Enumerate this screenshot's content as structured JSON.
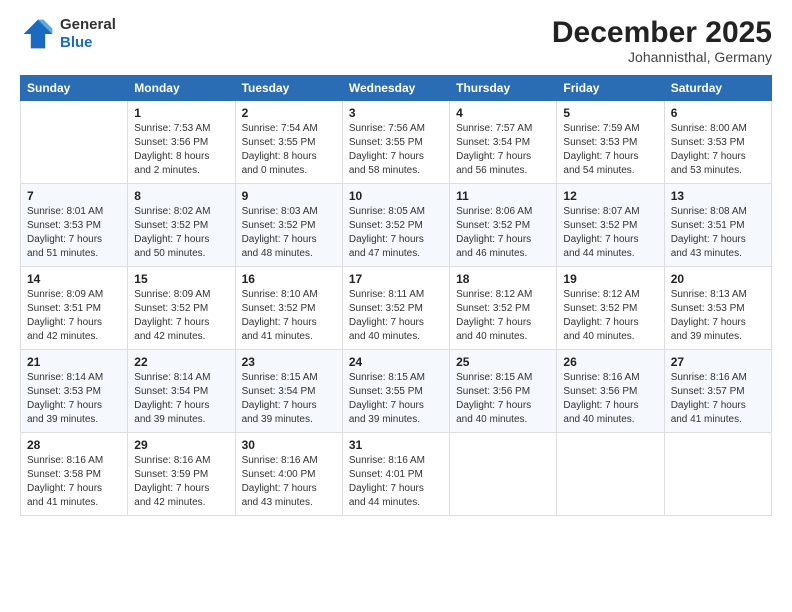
{
  "header": {
    "logo_general": "General",
    "logo_blue": "Blue",
    "month_title": "December 2025",
    "location": "Johannisthal, Germany"
  },
  "days_of_week": [
    "Sunday",
    "Monday",
    "Tuesday",
    "Wednesday",
    "Thursday",
    "Friday",
    "Saturday"
  ],
  "weeks": [
    [
      {
        "day": "",
        "info": ""
      },
      {
        "day": "1",
        "info": "Sunrise: 7:53 AM\nSunset: 3:56 PM\nDaylight: 8 hours\nand 2 minutes."
      },
      {
        "day": "2",
        "info": "Sunrise: 7:54 AM\nSunset: 3:55 PM\nDaylight: 8 hours\nand 0 minutes."
      },
      {
        "day": "3",
        "info": "Sunrise: 7:56 AM\nSunset: 3:55 PM\nDaylight: 7 hours\nand 58 minutes."
      },
      {
        "day": "4",
        "info": "Sunrise: 7:57 AM\nSunset: 3:54 PM\nDaylight: 7 hours\nand 56 minutes."
      },
      {
        "day": "5",
        "info": "Sunrise: 7:59 AM\nSunset: 3:53 PM\nDaylight: 7 hours\nand 54 minutes."
      },
      {
        "day": "6",
        "info": "Sunrise: 8:00 AM\nSunset: 3:53 PM\nDaylight: 7 hours\nand 53 minutes."
      }
    ],
    [
      {
        "day": "7",
        "info": "Sunrise: 8:01 AM\nSunset: 3:53 PM\nDaylight: 7 hours\nand 51 minutes."
      },
      {
        "day": "8",
        "info": "Sunrise: 8:02 AM\nSunset: 3:52 PM\nDaylight: 7 hours\nand 50 minutes."
      },
      {
        "day": "9",
        "info": "Sunrise: 8:03 AM\nSunset: 3:52 PM\nDaylight: 7 hours\nand 48 minutes."
      },
      {
        "day": "10",
        "info": "Sunrise: 8:05 AM\nSunset: 3:52 PM\nDaylight: 7 hours\nand 47 minutes."
      },
      {
        "day": "11",
        "info": "Sunrise: 8:06 AM\nSunset: 3:52 PM\nDaylight: 7 hours\nand 46 minutes."
      },
      {
        "day": "12",
        "info": "Sunrise: 8:07 AM\nSunset: 3:52 PM\nDaylight: 7 hours\nand 44 minutes."
      },
      {
        "day": "13",
        "info": "Sunrise: 8:08 AM\nSunset: 3:51 PM\nDaylight: 7 hours\nand 43 minutes."
      }
    ],
    [
      {
        "day": "14",
        "info": "Sunrise: 8:09 AM\nSunset: 3:51 PM\nDaylight: 7 hours\nand 42 minutes."
      },
      {
        "day": "15",
        "info": "Sunrise: 8:09 AM\nSunset: 3:52 PM\nDaylight: 7 hours\nand 42 minutes."
      },
      {
        "day": "16",
        "info": "Sunrise: 8:10 AM\nSunset: 3:52 PM\nDaylight: 7 hours\nand 41 minutes."
      },
      {
        "day": "17",
        "info": "Sunrise: 8:11 AM\nSunset: 3:52 PM\nDaylight: 7 hours\nand 40 minutes."
      },
      {
        "day": "18",
        "info": "Sunrise: 8:12 AM\nSunset: 3:52 PM\nDaylight: 7 hours\nand 40 minutes."
      },
      {
        "day": "19",
        "info": "Sunrise: 8:12 AM\nSunset: 3:52 PM\nDaylight: 7 hours\nand 40 minutes."
      },
      {
        "day": "20",
        "info": "Sunrise: 8:13 AM\nSunset: 3:53 PM\nDaylight: 7 hours\nand 39 minutes."
      }
    ],
    [
      {
        "day": "21",
        "info": "Sunrise: 8:14 AM\nSunset: 3:53 PM\nDaylight: 7 hours\nand 39 minutes."
      },
      {
        "day": "22",
        "info": "Sunrise: 8:14 AM\nSunset: 3:54 PM\nDaylight: 7 hours\nand 39 minutes."
      },
      {
        "day": "23",
        "info": "Sunrise: 8:15 AM\nSunset: 3:54 PM\nDaylight: 7 hours\nand 39 minutes."
      },
      {
        "day": "24",
        "info": "Sunrise: 8:15 AM\nSunset: 3:55 PM\nDaylight: 7 hours\nand 39 minutes."
      },
      {
        "day": "25",
        "info": "Sunrise: 8:15 AM\nSunset: 3:56 PM\nDaylight: 7 hours\nand 40 minutes."
      },
      {
        "day": "26",
        "info": "Sunrise: 8:16 AM\nSunset: 3:56 PM\nDaylight: 7 hours\nand 40 minutes."
      },
      {
        "day": "27",
        "info": "Sunrise: 8:16 AM\nSunset: 3:57 PM\nDaylight: 7 hours\nand 41 minutes."
      }
    ],
    [
      {
        "day": "28",
        "info": "Sunrise: 8:16 AM\nSunset: 3:58 PM\nDaylight: 7 hours\nand 41 minutes."
      },
      {
        "day": "29",
        "info": "Sunrise: 8:16 AM\nSunset: 3:59 PM\nDaylight: 7 hours\nand 42 minutes."
      },
      {
        "day": "30",
        "info": "Sunrise: 8:16 AM\nSunset: 4:00 PM\nDaylight: 7 hours\nand 43 minutes."
      },
      {
        "day": "31",
        "info": "Sunrise: 8:16 AM\nSunset: 4:01 PM\nDaylight: 7 hours\nand 44 minutes."
      },
      {
        "day": "",
        "info": ""
      },
      {
        "day": "",
        "info": ""
      },
      {
        "day": "",
        "info": ""
      }
    ]
  ]
}
